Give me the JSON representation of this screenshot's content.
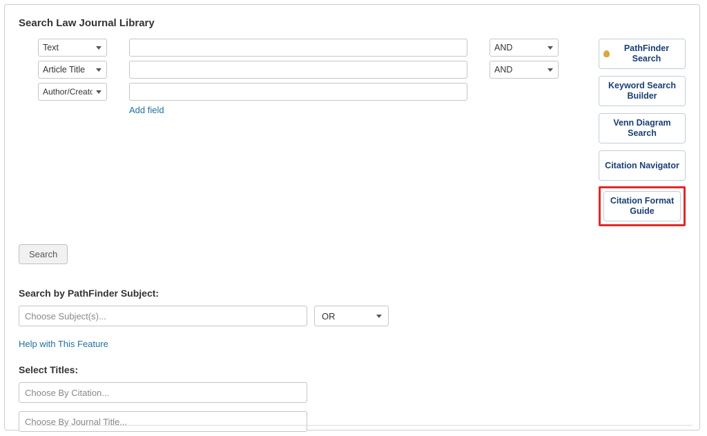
{
  "title": "Search Law Journal Library",
  "rows": [
    {
      "field": "Text",
      "operator": "AND"
    },
    {
      "field": "Article Title",
      "operator": "AND"
    },
    {
      "field": "Author/Creator",
      "operator": ""
    }
  ],
  "add_field": "Add field",
  "side": {
    "pathfinder": "PathFinder Search",
    "keyword": "Keyword Search Builder",
    "venn": "Venn Diagram Search",
    "citation_nav": "Citation Navigator",
    "citation_format": "Citation Format Guide"
  },
  "search_btn": "Search",
  "pathfinder_label": "Search by PathFinder Subject:",
  "subject_placeholder": "Choose Subject(s)...",
  "subject_logic": "OR",
  "help_link": "Help with This Feature",
  "titles_label": "Select Titles:",
  "citation_placeholder": "Choose By Citation...",
  "journal_placeholder": "Choose By Journal Title..."
}
